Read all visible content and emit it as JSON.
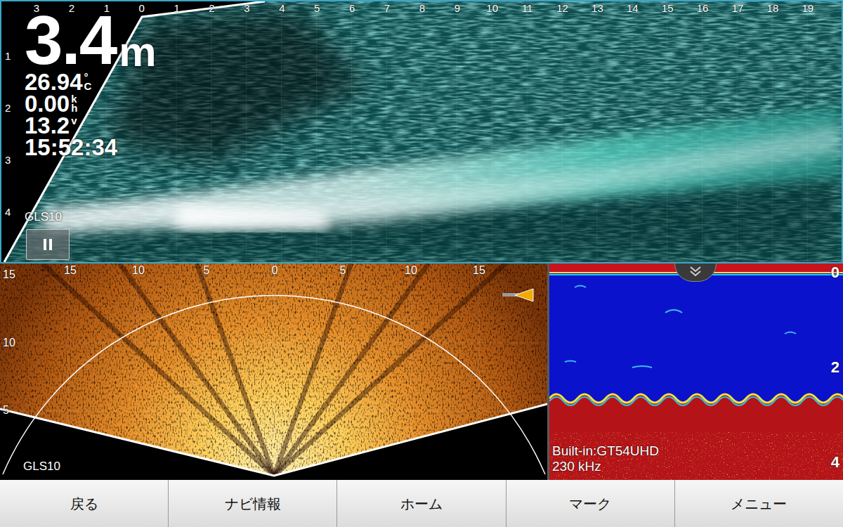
{
  "depth": {
    "value": "3.4",
    "unit": "m"
  },
  "readouts": [
    {
      "value": "26.94",
      "unit": "°C"
    },
    {
      "value": "0.00",
      "unit": "kh"
    },
    {
      "value": "13.2",
      "unit": "v"
    }
  ],
  "time": "15:52:34",
  "livescope": {
    "source": "GLS10",
    "range_labels": [
      "3",
      "2",
      "1",
      "0",
      "1",
      "2",
      "3",
      "4",
      "5",
      "6",
      "7",
      "8",
      "9",
      "10",
      "11",
      "12",
      "13",
      "14",
      "15",
      "16",
      "17",
      "18",
      "19"
    ],
    "depth_labels": [
      "1",
      "2",
      "3",
      "4"
    ]
  },
  "forward": {
    "source": "GLS10",
    "range_labels": [
      "15",
      "10",
      "5",
      "0",
      "5",
      "10",
      "15"
    ],
    "depth_labels": [
      "15",
      "10",
      "5"
    ]
  },
  "sounder": {
    "source": "Built-in:GT54UHD",
    "frequency": "230 kHz",
    "depth_labels": [
      "0",
      "2",
      "4"
    ]
  },
  "softkeys": [
    "戻る",
    "ナビ情報",
    "ホーム",
    "マーク",
    "メニュー"
  ]
}
